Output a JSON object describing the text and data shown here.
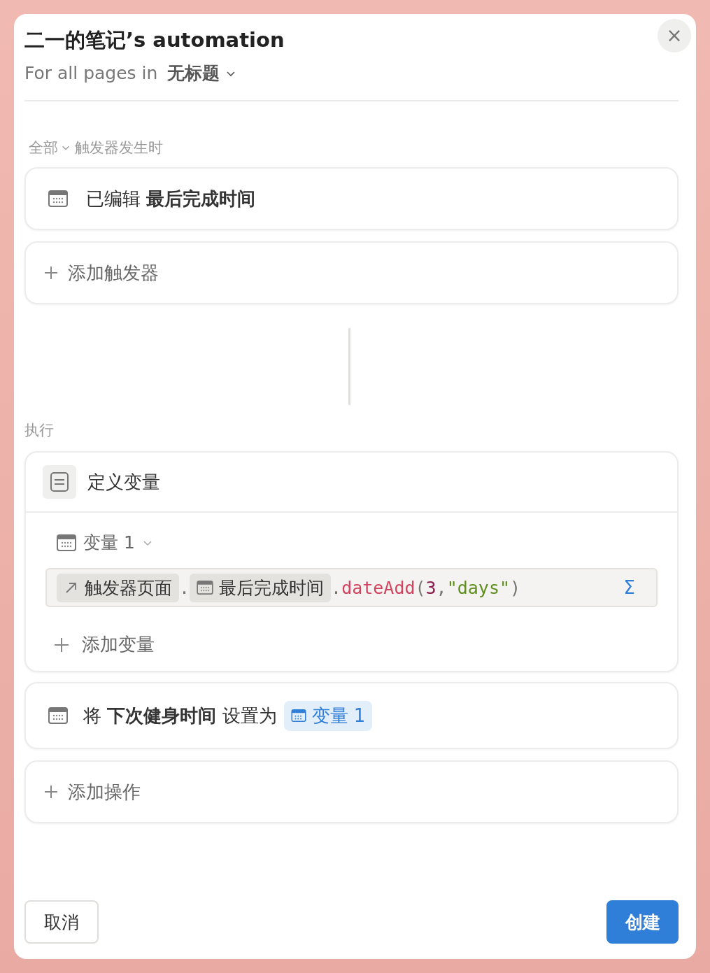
{
  "dialog": {
    "title": "二一的笔记’s automation",
    "subtitle": "For all pages in",
    "database": "无标题",
    "close": "×"
  },
  "trigger_section": {
    "mode": "全部",
    "label": "触发器发生时"
  },
  "triggers": [
    {
      "text": "已编辑 **最后完成时间**"
    }
  ],
  "add_trigger": "添加触发器",
  "actions_label": "执行",
  "define_variables": {
    "title": "定义变量",
    "variables": [
      {
        "name": "变量 1",
        "formula": [
          {
            "kind": "page",
            "text": "触发器页面"
          },
          {
            "kind": "punct",
            "text": "."
          },
          {
            "kind": "property",
            "text": "最后完成时间"
          },
          {
            "kind": "punct",
            "text": "."
          },
          {
            "kind": "function",
            "text": "dateAdd"
          },
          {
            "kind": "punct",
            "text": "("
          },
          {
            "kind": "number",
            "text": "3"
          },
          {
            "kind": "punct",
            "text": ","
          },
          {
            "kind": "string",
            "text": "\"days\""
          },
          {
            "kind": "punct",
            "text": ")"
          }
        ],
        "formula_icon": "Σ"
      }
    ],
    "add_variable": "添加变量"
  },
  "set_action": {
    "text": "将 **下次健身时间** 设置为",
    "value": "变量 1"
  },
  "add_action": "添加操作",
  "buttons": {
    "cancel": "取消",
    "create": "创建"
  }
}
